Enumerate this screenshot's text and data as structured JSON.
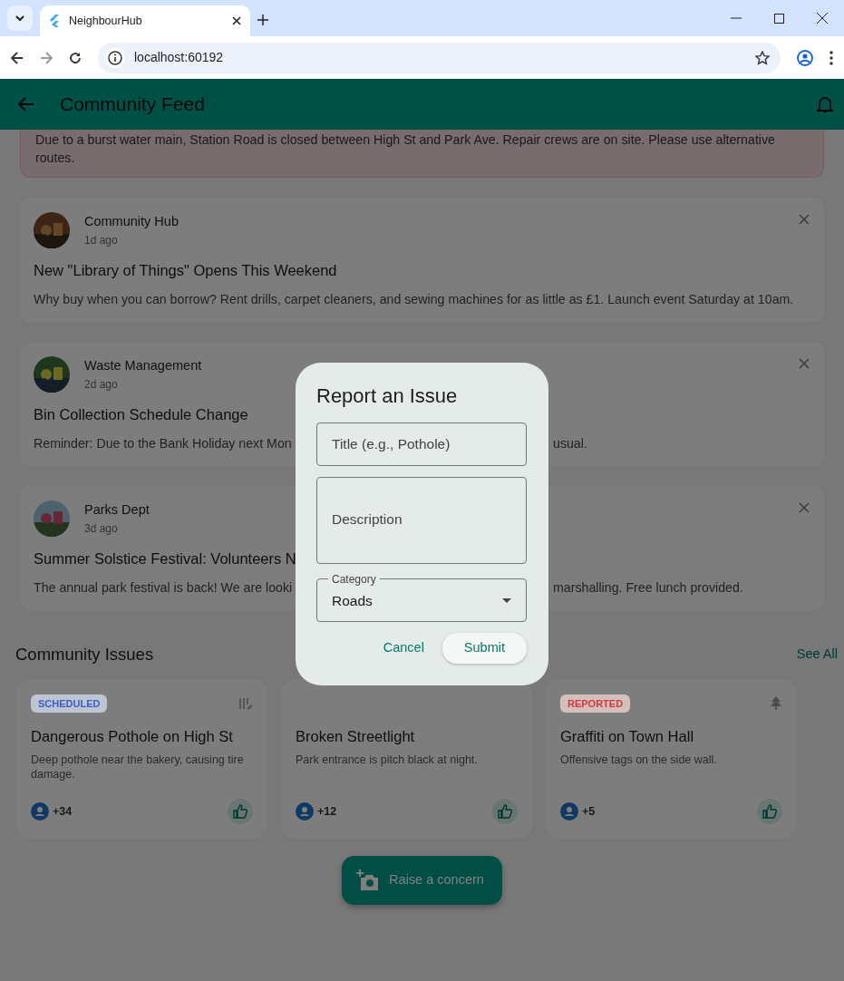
{
  "browser": {
    "tab_title": "NeighbourHub",
    "url": "localhost:60192"
  },
  "app_bar": {
    "title": "Community Feed"
  },
  "alert": {
    "text": "Due to a burst water main, Station Road is closed between High St and Park Ave. Repair crews are on site. Please use alternative routes."
  },
  "posts": [
    {
      "author": "Community Hub",
      "time": "1d ago",
      "title": "New \"Library of Things\" Opens This Weekend",
      "body": [
        "Why buy when you can borrow? Rent drills, carpet cleaners, and sewing machines for as little as £1. Launch event Saturday at 10am."
      ]
    },
    {
      "author": "Waste Management",
      "time": "2d ago",
      "title": "Bin Collection Schedule Change",
      "body": [
        "Reminder: Due to the Bank Holiday next Mon",
        "usual."
      ]
    },
    {
      "author": "Parks Dept",
      "time": "3d ago",
      "title": "Summer Solstice Festival: Volunteers N",
      "body": [
        "The annual park festival is back! We are looki",
        "marshalling. Free lunch provided."
      ]
    }
  ],
  "issues_section": {
    "title": "Community Issues",
    "link": "See All"
  },
  "issues": [
    {
      "kind": "scheduled",
      "badge": {
        "label": "SCHEDULED",
        "color": "#3a5fc8"
      },
      "title": "Dangerous Pothole on High St",
      "description": "Deep pothole near the bakery, causing tire damage.",
      "votes": "+34"
    },
    {
      "kind": "covered",
      "title": "Broken Streetlight",
      "description": "Park entrance is pitch black at night.",
      "votes": "+12"
    },
    {
      "kind": "reported",
      "badge": {
        "label": "REPORTED",
        "color": "#d13a3a"
      },
      "title": "Graffiti on Town Hall",
      "description": "Offensive tags on the side wall.",
      "votes": "+5"
    }
  ],
  "fab": {
    "label": "Raise a concern"
  },
  "dialog": {
    "title": "Report an Issue",
    "fields": [
      {
        "kind": "text",
        "placeholder": "Title (e.g., Pothole)"
      },
      {
        "kind": "textarea",
        "placeholder": "Description"
      },
      {
        "kind": "select",
        "label": "Category",
        "value": "Roads"
      }
    ],
    "buttons": [
      {
        "kind": "text",
        "label": "Cancel"
      },
      {
        "kind": "filled",
        "label": "Submit"
      }
    ]
  }
}
